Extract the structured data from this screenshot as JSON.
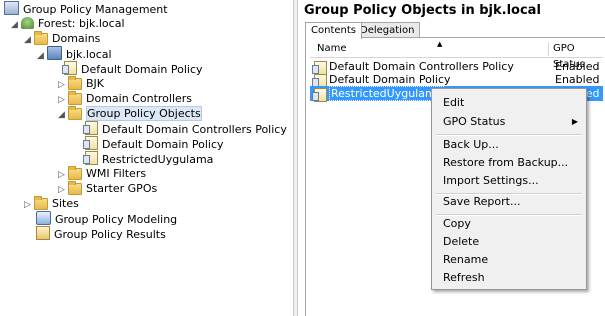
{
  "tree": {
    "root": "Group Policy Management",
    "forest": "Forest: bjk.local",
    "domains": "Domains",
    "domain": "bjk.local",
    "default_domain_policy": "Default Domain Policy",
    "bjk": "BJK",
    "domain_controllers": "Domain Controllers",
    "gpo_container": "Group Policy Objects",
    "gpo_items": [
      "Default Domain Controllers Policy",
      "Default Domain Policy",
      "RestrictedUygulama"
    ],
    "wmi_filters": "WMI Filters",
    "starter_gpos": "Starter GPOs",
    "sites": "Sites",
    "modeling": "Group Policy Modeling",
    "results": "Group Policy Results"
  },
  "right": {
    "title": "Group Policy Objects in bjk.local",
    "tabs": [
      "Contents",
      "Delegation"
    ],
    "columns": {
      "name": "Name",
      "status": "GPO Status"
    },
    "rows": [
      {
        "name": "Default Domain Controllers Policy",
        "status": "Enabled"
      },
      {
        "name": "Default Domain Policy",
        "status": "Enabled"
      },
      {
        "name": "RestrictedUygulama",
        "status": "Enabled"
      }
    ]
  },
  "context_menu": {
    "items": [
      "Edit",
      "GPO Status",
      "Back Up...",
      "Restore from Backup...",
      "Import Settings...",
      "Save Report...",
      "Copy",
      "Delete",
      "Rename",
      "Refresh"
    ]
  }
}
